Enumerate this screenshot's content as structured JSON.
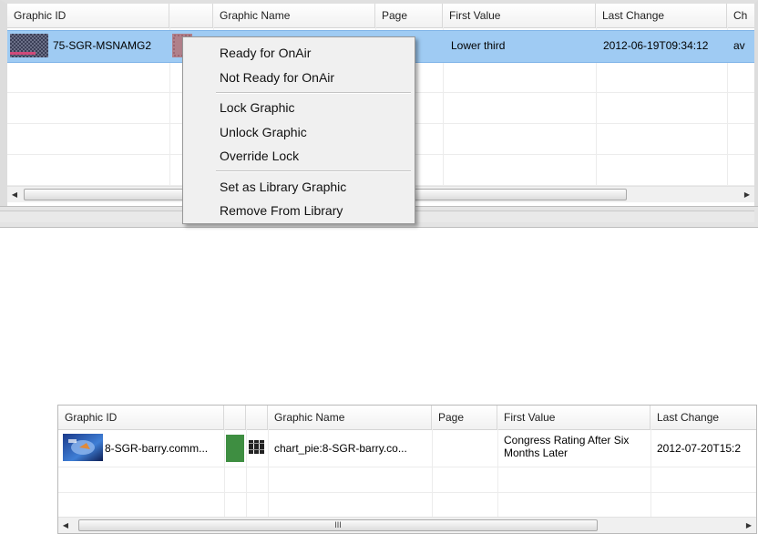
{
  "top_panel": {
    "columns": [
      "Graphic ID",
      "",
      "Graphic Name",
      "Page",
      "First Value",
      "Last Change",
      "Ch"
    ],
    "row": {
      "graphic_id": "75-SGR-MSNAMG2",
      "graphic_name": "",
      "first_value": "Lower third",
      "last_change": "2012-06-19T09:34:12",
      "ch": "av"
    },
    "selection_color": "#9fcbf3"
  },
  "context_menu": {
    "items": [
      "Ready for OnAir",
      "Not Ready for OnAir",
      "Lock Graphic",
      "Unlock Graphic",
      "Override Lock",
      "Set as Library Graphic",
      "Remove From Library"
    ]
  },
  "bottom_panel": {
    "columns": [
      "Graphic ID",
      "",
      "",
      "Graphic Name",
      "Page",
      "First Value",
      "Last Change"
    ],
    "row": {
      "graphic_id": "8-SGR-barry.comm...",
      "graphic_name": "chart_pie:8-SGR-barry.co...",
      "first_value": "Congress Rating After Six Months Later",
      "last_change": "2012-07-20T15:2",
      "status_color": "#3e8e41"
    },
    "scroll_grip": "III"
  }
}
